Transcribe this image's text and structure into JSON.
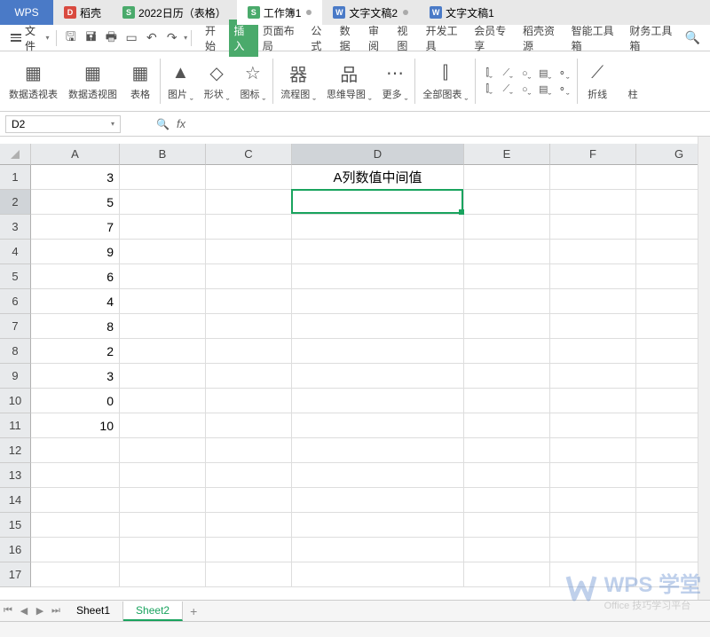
{
  "title_tabs": [
    {
      "label": "WPS",
      "icon_class": "",
      "active": false,
      "wps": true
    },
    {
      "label": "稻壳",
      "icon_class": "icon-red",
      "icon_text": "D"
    },
    {
      "label": "2022日历（表格）",
      "icon_class": "icon-green",
      "icon_text": "S"
    },
    {
      "label": "工作簿1",
      "icon_class": "icon-green",
      "icon_text": "S",
      "active": true,
      "dot": true
    },
    {
      "label": "文字文稿2",
      "icon_class": "icon-blue",
      "icon_text": "W",
      "dot": true
    },
    {
      "label": "文字文稿1",
      "icon_class": "icon-blue",
      "icon_text": "W"
    }
  ],
  "menu": {
    "file": "文件"
  },
  "ribbon_tabs": [
    "开始",
    "插入",
    "页面布局",
    "公式",
    "数据",
    "审阅",
    "视图",
    "开发工具",
    "会员专享",
    "稻壳资源",
    "智能工具箱",
    "财务工具箱"
  ],
  "active_ribbon_tab": 1,
  "ribbon_buttons": [
    {
      "label": "数据透视表",
      "glyph": "▦"
    },
    {
      "label": "数据透视图",
      "glyph": "▦"
    },
    {
      "label": "表格",
      "glyph": "▦"
    },
    {
      "label": "图片",
      "glyph": "▲",
      "arrow": true
    },
    {
      "label": "形状",
      "glyph": "◇",
      "arrow": true
    },
    {
      "label": "图标",
      "glyph": "☆",
      "arrow": true
    },
    {
      "label": "流程图",
      "glyph": "器",
      "arrow": true
    },
    {
      "label": "思维导图",
      "glyph": "品",
      "arrow": true
    },
    {
      "label": "更多",
      "glyph": "⋯",
      "arrow": true
    },
    {
      "label": "全部图表",
      "glyph": "⫿",
      "arrow": true
    },
    {
      "label": "折线",
      "glyph": "⟋"
    },
    {
      "label": "柱"
    }
  ],
  "address": {
    "name_box": "D2",
    "fx": "fx",
    "formula": ""
  },
  "columns": [
    "A",
    "B",
    "C",
    "D",
    "E",
    "F",
    "G"
  ],
  "chart_data": {
    "type": "table",
    "title": "A列数值中间值",
    "columns": [
      "A"
    ],
    "rows": [
      [
        3
      ],
      [
        5
      ],
      [
        7
      ],
      [
        9
      ],
      [
        6
      ],
      [
        4
      ],
      [
        8
      ],
      [
        2
      ],
      [
        3
      ],
      [
        0
      ],
      [
        10
      ]
    ]
  },
  "cells": {
    "A": [
      "3",
      "5",
      "7",
      "9",
      "6",
      "4",
      "8",
      "2",
      "3",
      "0",
      "10"
    ],
    "D1": "A列数值中间值"
  },
  "row_count": 17,
  "active_cell": {
    "col": "D",
    "row": 2
  },
  "sheet_tabs": [
    "Sheet1",
    "Sheet2"
  ],
  "active_sheet": 1,
  "watermark": {
    "main": "WPS 学堂",
    "sub": "Office 技巧学习平台"
  }
}
